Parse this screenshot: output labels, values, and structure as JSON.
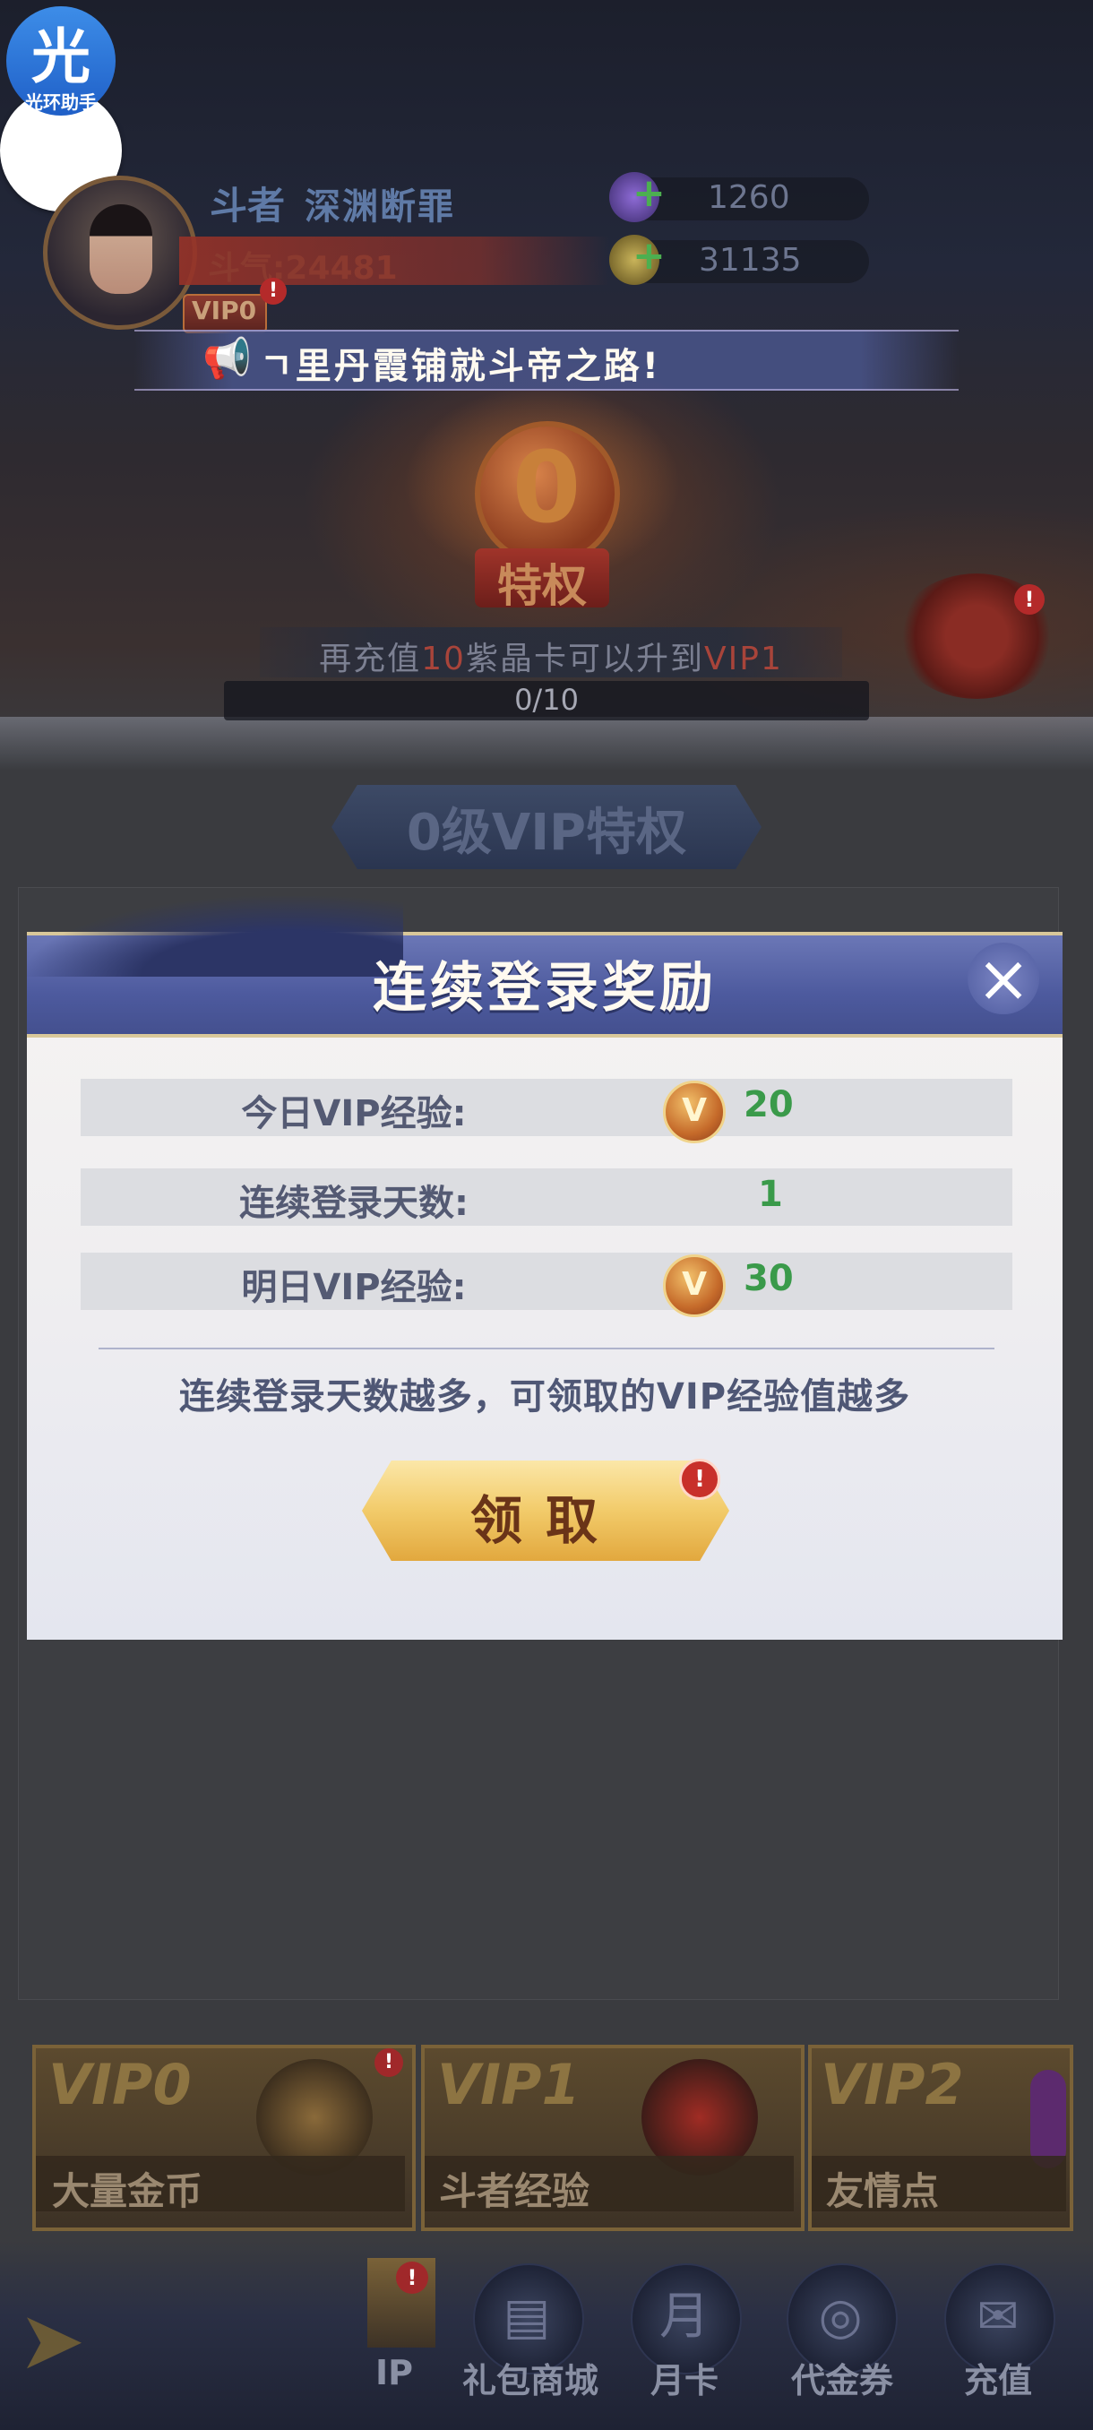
{
  "helper": {
    "glyph": "光",
    "label": "光环助手"
  },
  "player": {
    "rank": "斗者",
    "name": "深渊断罪",
    "power": "斗气:24481",
    "vip_tag": "VIP0",
    "vip_alert": "!",
    "resources": [
      {
        "icon": "purple-crystal-icon",
        "value": "1260"
      },
      {
        "icon": "gold-coin-icon",
        "value": "31135"
      }
    ]
  },
  "marquee": {
    "text": "ㄱ里丹霞铺就斗帝之路!"
  },
  "vip_emblem": {
    "level": "0",
    "label": "特权"
  },
  "recharge": {
    "prefix": "再充值",
    "amount": "10",
    "middle": "紫晶卡可以升到",
    "target": "VIP1",
    "progress_text": "0/10",
    "progress_fraction": 0.0
  },
  "gift_alert": "!",
  "vip_section_title": "0级VIP特权",
  "modal": {
    "title": "连续登录奖励",
    "rows": [
      {
        "label": "今日VIP经验:",
        "icon": "V",
        "value": "20"
      },
      {
        "label": "连续登录天数:",
        "value": "1"
      },
      {
        "label": "明日VIP经验:",
        "icon": "V",
        "value": "30"
      }
    ],
    "hint": "连续登录天数越多，可领取的VIP经验值越多",
    "claim_label": "领取",
    "claim_alert": "!"
  },
  "vip_cards": [
    {
      "vip": "VIP0",
      "label": "大量金币",
      "alert": "!"
    },
    {
      "vip": "VIP1",
      "label": "斗者经验"
    },
    {
      "vip": "VIP2",
      "label": "友情点"
    }
  ],
  "nav": {
    "vip_label": "IP",
    "vip_alert": "!",
    "shop_label": "礼包商城",
    "month_label": "月卡",
    "month_glyph": "月",
    "voucher_label": "代金券",
    "recharge_label": "充值"
  },
  "colors": {
    "modal_header": "#4d5a9e",
    "accent_green": "#3a9a4a",
    "claim_gold": "#f2cb6a",
    "alert_red": "#b42a2a"
  }
}
